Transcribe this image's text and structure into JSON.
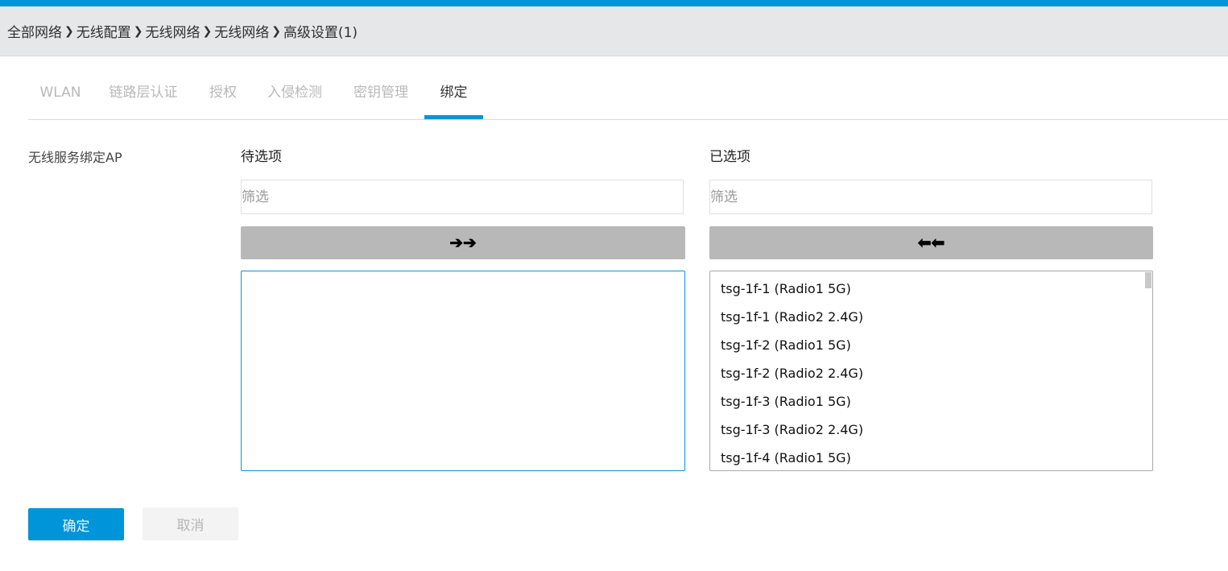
{
  "breadcrumb": {
    "items": [
      "全部网络",
      "无线配置",
      "无线网络",
      "无线网络",
      "高级设置(1)"
    ],
    "separator": "❯"
  },
  "tabs": [
    {
      "label": "WLAN",
      "active": false
    },
    {
      "label": "链路层认证",
      "active": false
    },
    {
      "label": "授权",
      "active": false
    },
    {
      "label": "入侵检测",
      "active": false
    },
    {
      "label": "密钥管理",
      "active": false
    },
    {
      "label": "绑定",
      "active": true
    }
  ],
  "binding": {
    "field_label": "无线服务绑定AP",
    "available": {
      "title": "待选项",
      "filter_placeholder": "筛选",
      "filter_value": "",
      "move_label": "➔➔",
      "items": []
    },
    "selected": {
      "title": "已选项",
      "filter_placeholder": "筛选",
      "filter_value": "",
      "move_label": "⬅⬅",
      "items": [
        "tsg-1f-1 (Radio1 5G)",
        "tsg-1f-1 (Radio2 2.4G)",
        "tsg-1f-2 (Radio1 5G)",
        "tsg-1f-2 (Radio2 2.4G)",
        "tsg-1f-3 (Radio1 5G)",
        "tsg-1f-3 (Radio2 2.4G)",
        "tsg-1f-4 (Radio1 5G)"
      ]
    }
  },
  "actions": {
    "ok_label": "确定",
    "cancel_label": "取消"
  },
  "colors": {
    "accent": "#0095d9",
    "move_button": "#b8b8b9"
  }
}
